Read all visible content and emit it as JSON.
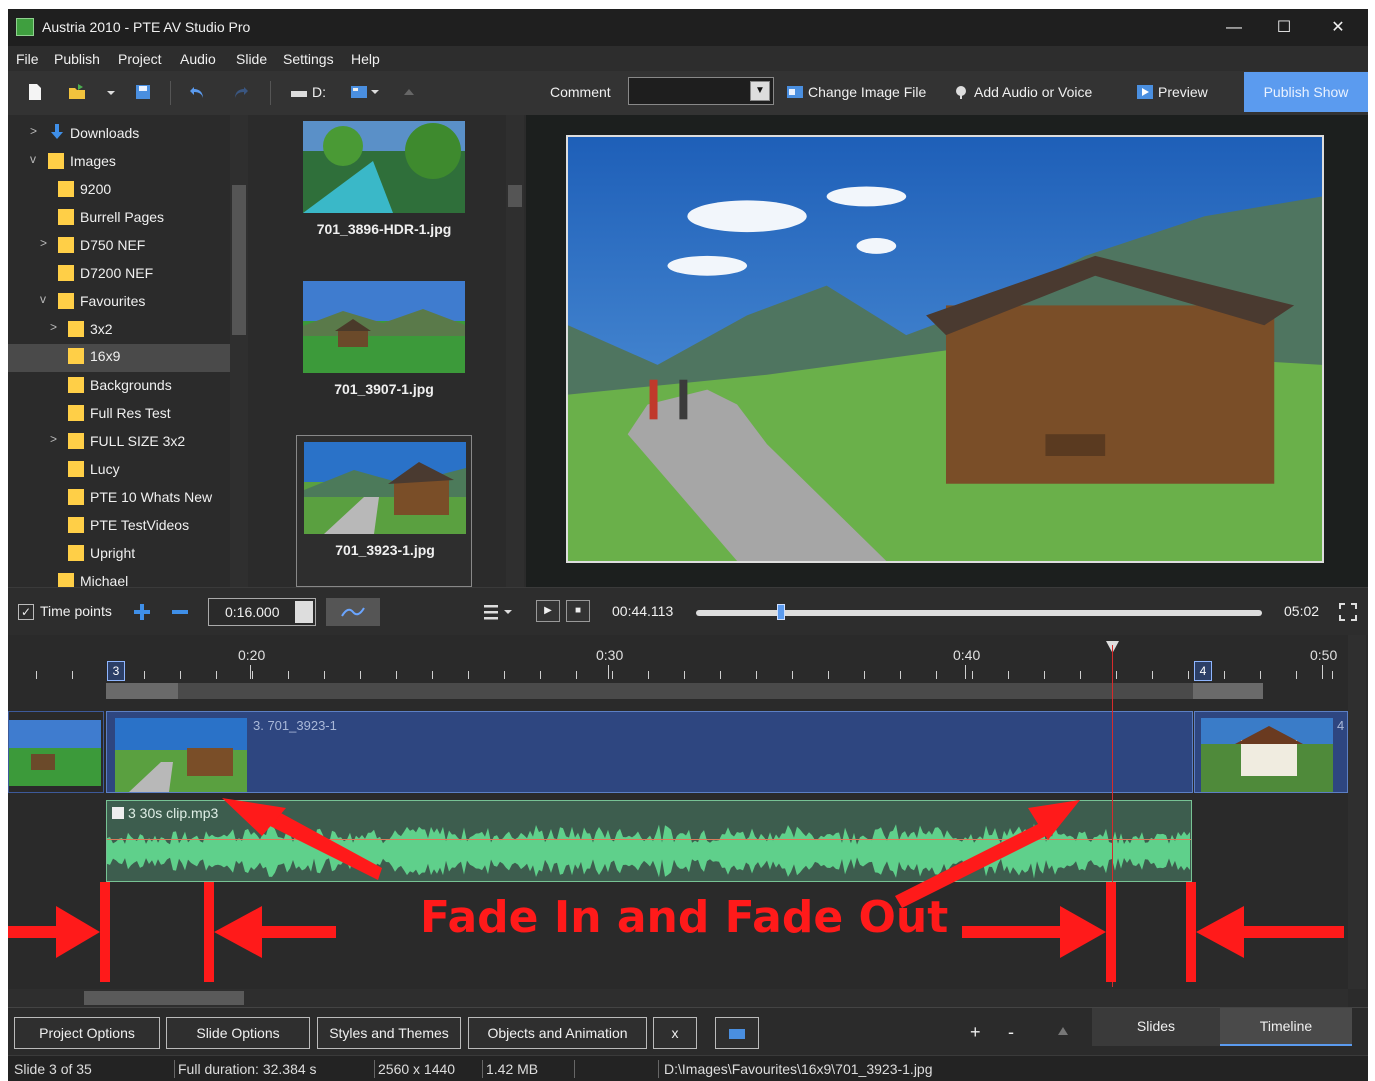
{
  "window": {
    "title": "Austria 2010 - PTE AV Studio Pro"
  },
  "window_buttons": {
    "minimize": "—",
    "maximize": "☐",
    "close": "✕"
  },
  "menu": [
    "File",
    "Publish",
    "Project",
    "Audio",
    "Slide",
    "Settings",
    "Help"
  ],
  "toolbar": {
    "drive_label": "D:",
    "comment_label": "Comment",
    "comment_value": "",
    "change_image_label": "Change Image File",
    "add_audio_label": "Add Audio or Voice",
    "preview_label": "Preview",
    "publish_label": "Publish Show"
  },
  "folder_tree": [
    {
      "label": "Downloads",
      "expanded": false,
      "has_children": true,
      "icon": "download-arrow-icon"
    },
    {
      "label": "Images",
      "expanded": true,
      "has_children": true
    },
    {
      "label": "9200"
    },
    {
      "label": "Burrell Pages"
    },
    {
      "label": "D750 NEF",
      "has_children": true
    },
    {
      "label": "D7200 NEF"
    },
    {
      "label": "Favourites",
      "expanded": true,
      "has_children": true
    },
    {
      "label": "3x2",
      "has_children": true
    },
    {
      "label": "16x9",
      "selected": true
    },
    {
      "label": "Backgrounds"
    },
    {
      "label": "Full Res Test"
    },
    {
      "label": "FULL SIZE 3x2",
      "has_children": true
    },
    {
      "label": "Lucy"
    },
    {
      "label": "PTE 10 Whats New"
    },
    {
      "label": "PTE TestVideos"
    },
    {
      "label": "Upright"
    },
    {
      "label": "Michael"
    }
  ],
  "thumbnails": [
    {
      "caption": "701_3896-HDR-1.jpg"
    },
    {
      "caption": "701_3907-1.jpg"
    },
    {
      "caption": "701_3923-1.jpg",
      "selected": true
    }
  ],
  "controls": {
    "time_points_checked": true,
    "time_points_label": "Time points",
    "time_value": "0:16.000",
    "current_time": "00:44.113",
    "total_time": "05:02",
    "position_fraction": 0.15
  },
  "timeline": {
    "ruler_labels": [
      "0:20",
      "0:30",
      "0:40",
      "0:50"
    ],
    "slide_markers": [
      "3",
      "4"
    ],
    "slide_label": "3. 701_3923-1",
    "next_slide_partial": "4",
    "audio_clip_label": "3  30s clip.mp3"
  },
  "annotation": {
    "text": "Fade In and Fade Out",
    "color": "#ff1a1a"
  },
  "bottom_buttons": {
    "project_options": "Project Options",
    "slide_options": "Slide Options",
    "styles_themes": "Styles and Themes",
    "objects_animation": "Objects and Animation",
    "x": "x",
    "plus": "+",
    "minus": "-",
    "slides_tab": "Slides",
    "timeline_tab": "Timeline",
    "active_tab": "Timeline"
  },
  "status": {
    "slide": "Slide 3 of 35",
    "duration": "Full duration: 32.384 s",
    "resolution": "2560 x 1440",
    "filesize": "1.42 MB",
    "path": "D:\\Images\\Favourites\\16x9\\701_3923-1.jpg"
  },
  "colors": {
    "accent": "#5b9bef",
    "folder": "#ffcf47",
    "audio_wave": "#5fd08b",
    "slide_track": "#2e4680",
    "playhead": "#d62b2b"
  }
}
